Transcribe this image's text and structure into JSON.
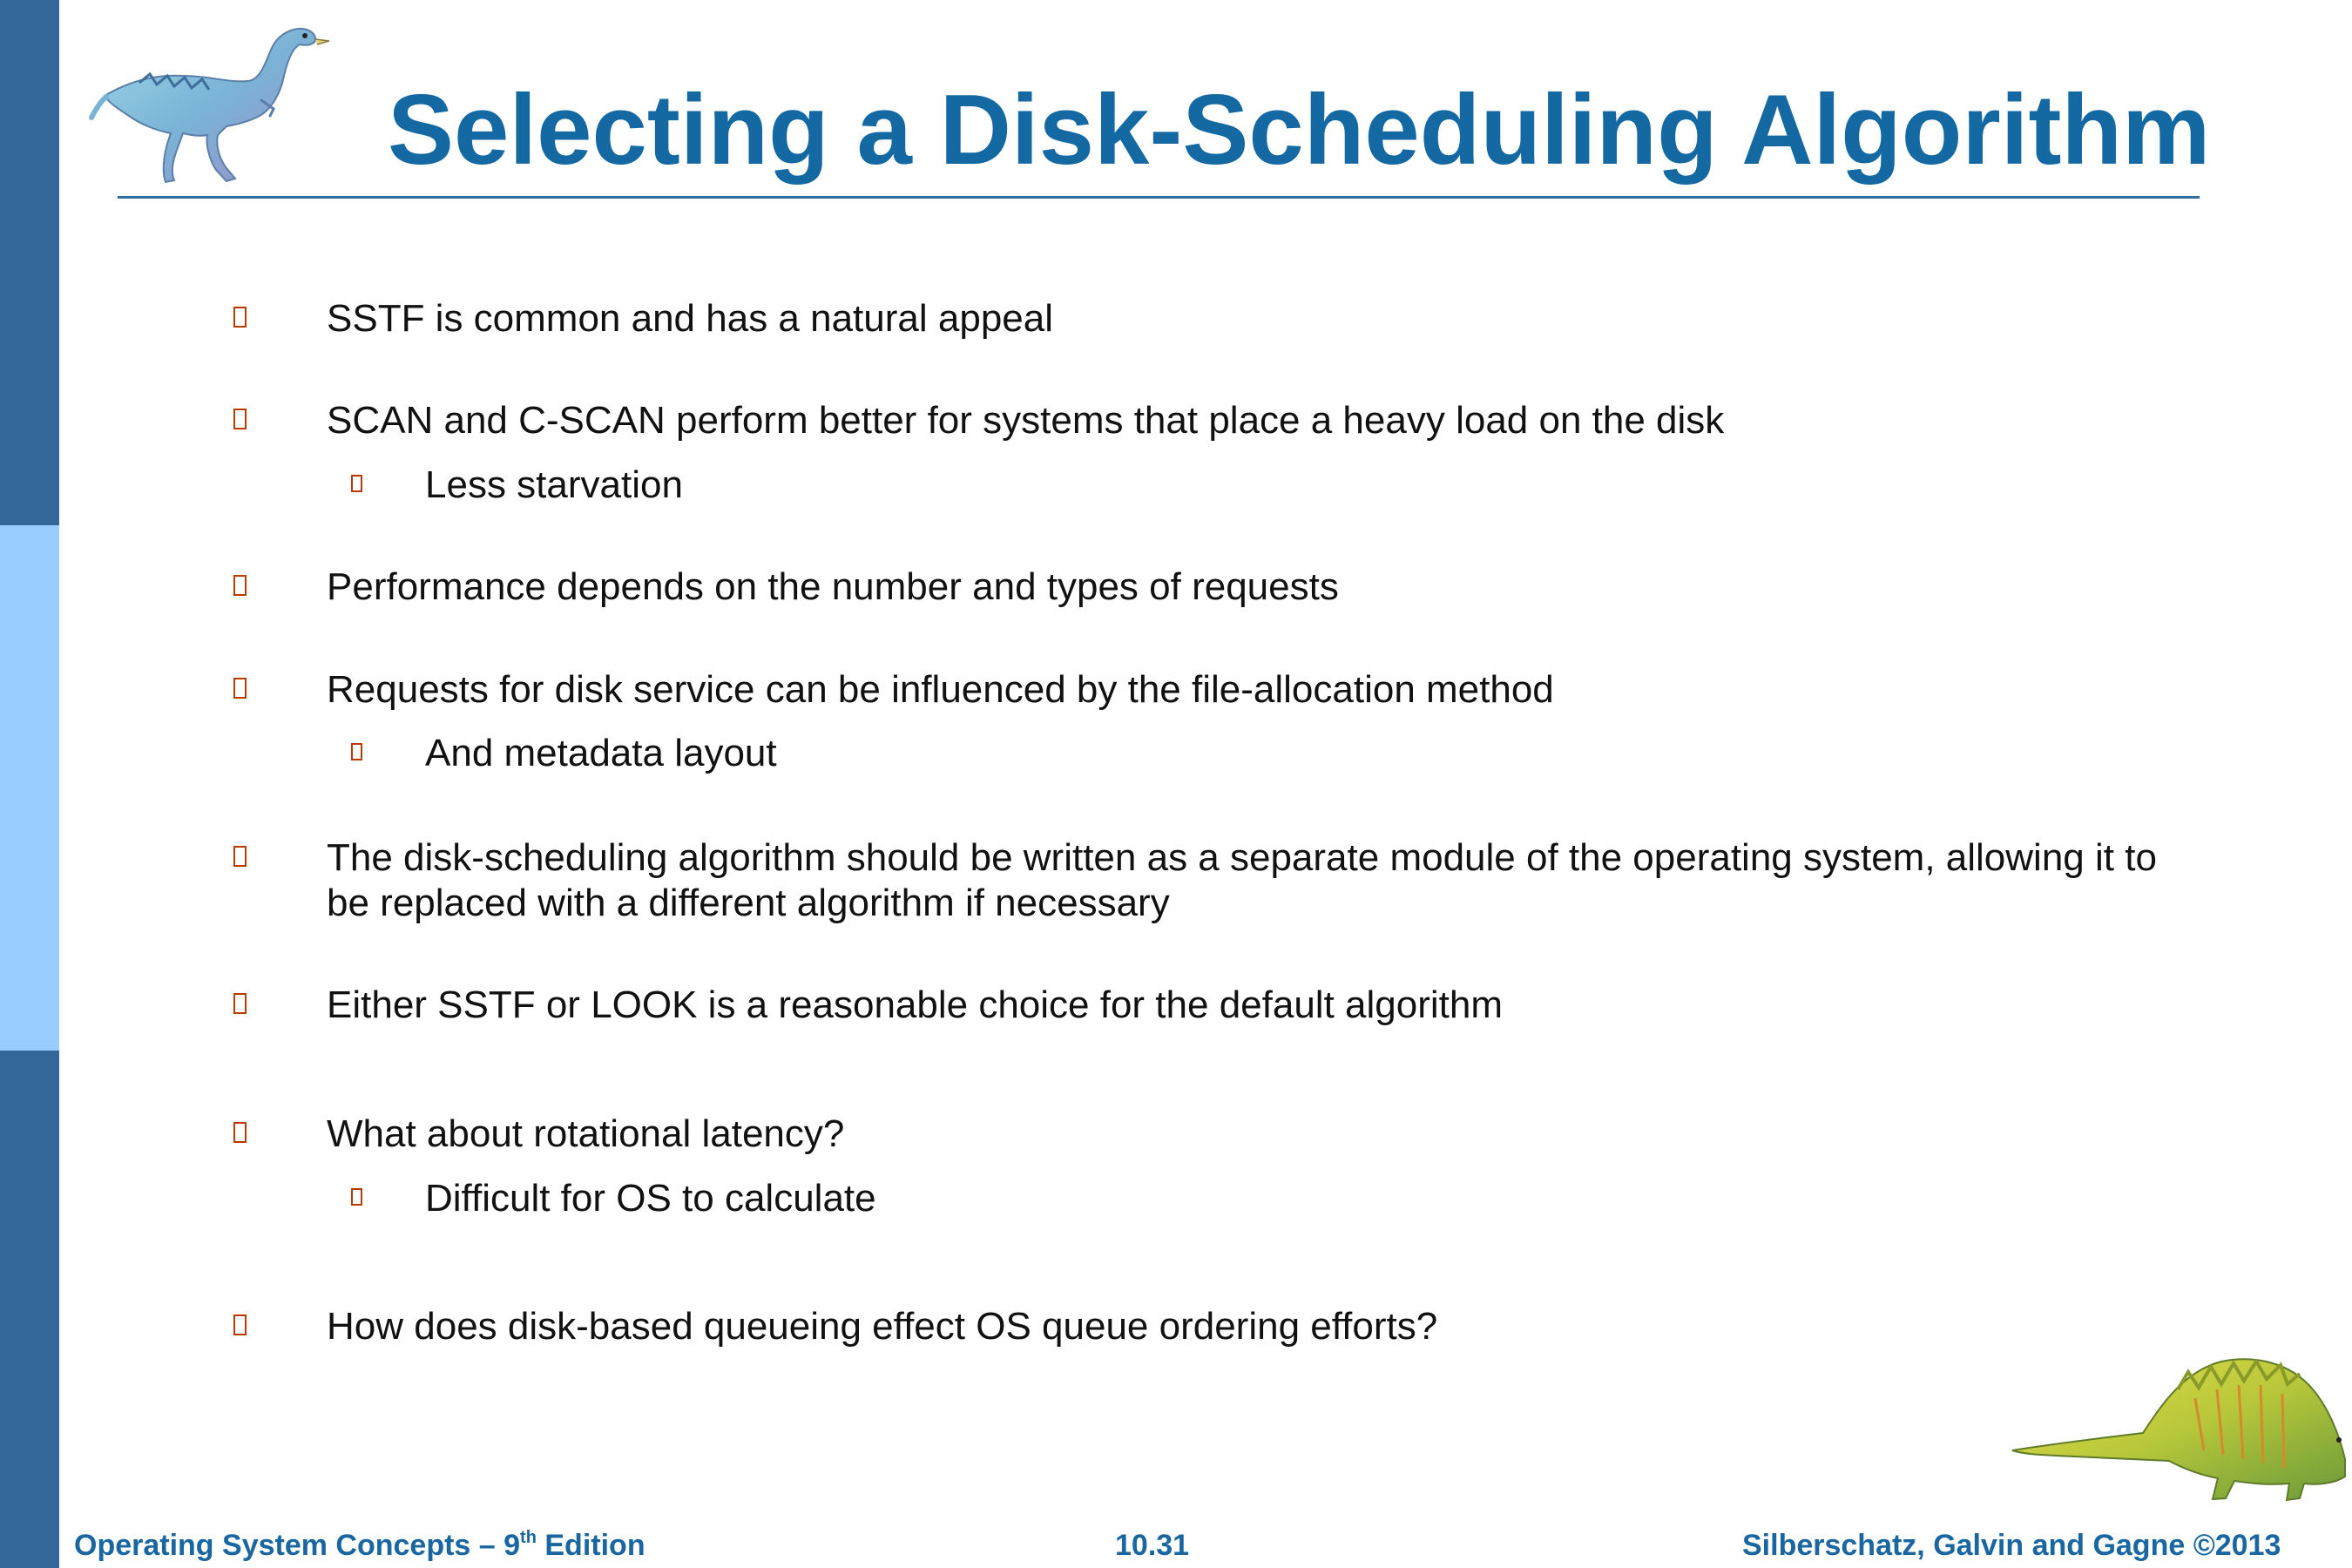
{
  "slide": {
    "title": "Selecting a Disk-Scheduling Algorithm",
    "bullets": [
      {
        "text": "SSTF is common and has a natural appeal"
      },
      {
        "text": "SCAN and C-SCAN perform better for systems that place a heavy load on the disk"
      },
      {
        "text": "Less starvation"
      },
      {
        "text": "Performance depends on the number and types of requests"
      },
      {
        "text": "Requests for disk service can be influenced by the file-allocation method"
      },
      {
        "text": "And metadata layout"
      },
      {
        "text": "The disk-scheduling algorithm should be written as a separate module of the operating system, allowing it to be replaced with a different algorithm if necessary"
      },
      {
        "text": "Either SSTF or LOOK is a reasonable choice for the default algorithm"
      },
      {
        "text": "What about rotational latency?"
      },
      {
        "text": "Difficult for OS to calculate"
      },
      {
        "text": "How does disk-based queueing effect OS queue ordering efforts?"
      }
    ]
  },
  "footer": {
    "book_prefix": "Operating System Concepts – 9",
    "book_sup": "th",
    "book_suffix": " Edition",
    "page_number": "10.31",
    "copyright": "Silberschatz, Galvin and Gagne ©2013"
  },
  "colors": {
    "title": "#1569a3",
    "sidebar_dark": "#336699",
    "sidebar_light": "#99ccff",
    "bullet_marker": "#b83c00",
    "footer_text": "#1a66a0"
  },
  "icons": [
    "dinosaur-logo-icon",
    "dinosaur-decoration-icon"
  ]
}
